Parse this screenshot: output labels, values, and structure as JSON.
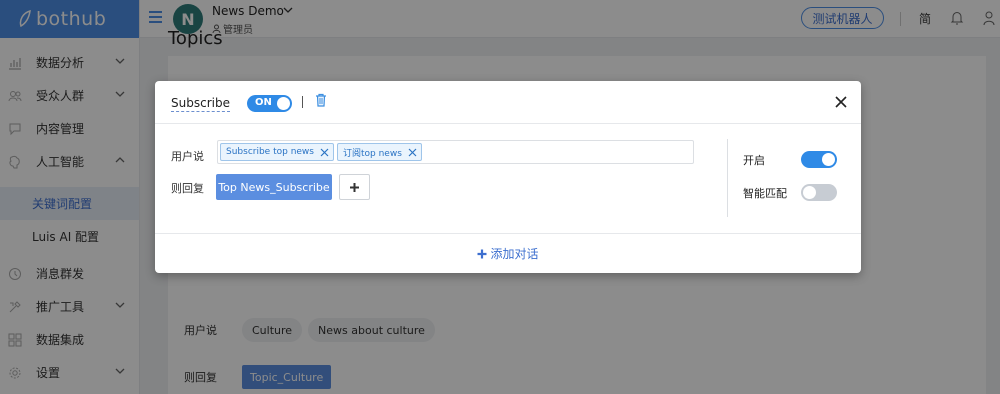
{
  "brand": {
    "name": "bothub"
  },
  "sidebar": {
    "items": [
      {
        "label": "数据分析",
        "icon": "chart-icon",
        "has_chevron": true
      },
      {
        "label": "受众人群",
        "icon": "people-icon",
        "has_chevron": true
      },
      {
        "label": "内容管理",
        "icon": "chat-icon",
        "has_chevron": false
      },
      {
        "label": "人工智能",
        "icon": "brain-icon",
        "has_chevron": true,
        "expanded": true
      }
    ],
    "sub_items": [
      {
        "label": "关键词配置",
        "active": true
      },
      {
        "label": "Luis AI 配置",
        "active": false
      }
    ],
    "items_after": [
      {
        "label": "消息群发",
        "icon": "clock-icon",
        "has_chevron": false
      },
      {
        "label": "推广工具",
        "icon": "tools-icon",
        "has_chevron": true
      },
      {
        "label": "数据集成",
        "icon": "grid-icon",
        "has_chevron": false
      },
      {
        "label": "设置",
        "icon": "gear-icon",
        "has_chevron": true
      }
    ]
  },
  "header": {
    "avatar_letter": "N",
    "project_name": "News Demo",
    "role": "管理员",
    "test_bot_label": "测试机器人",
    "lang_label": "简"
  },
  "background": {
    "page_title": "Topics",
    "user_says_label": "用户说",
    "reply_label": "则回复",
    "user_says_chips": [
      "Culture",
      "News about culture"
    ],
    "reply_value": "Topic_Culture"
  },
  "modal": {
    "title": "Subscribe",
    "toggle_label": "ON",
    "user_says_label": "用户说",
    "reply_label": "则回复",
    "tags": [
      "Subscribe top news",
      "订阅top news"
    ],
    "reply_value": "Top News_Subscribe",
    "enable_label": "开启",
    "enable_on": true,
    "smart_match_label": "智能匹配",
    "smart_match_on": false,
    "add_dialog_label": "添加对话"
  },
  "colors": {
    "accent": "#4d8fe6",
    "toggle_on": "#2f8ae6",
    "toggle_off": "#c7ccd3",
    "reply_button": "#5b8ee0"
  }
}
